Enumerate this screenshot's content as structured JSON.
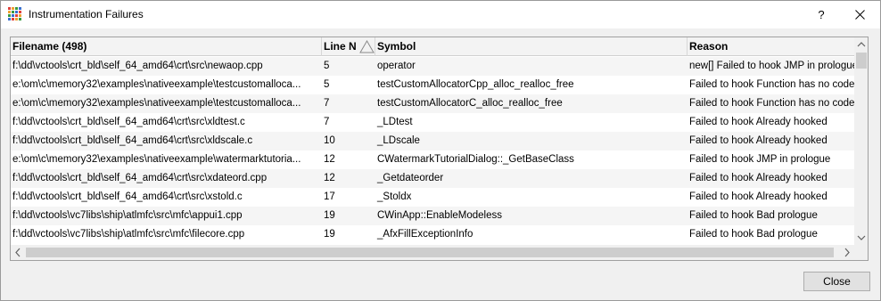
{
  "window": {
    "title": "Instrumentation Failures",
    "help_label": "?"
  },
  "table": {
    "columns": [
      {
        "label": "Filename (498)"
      },
      {
        "label": "Line N"
      },
      {
        "label": "Symbol"
      },
      {
        "label": "Reason"
      }
    ],
    "sort": {
      "column": "Line N",
      "direction": "ascending"
    },
    "rows": [
      {
        "filename": "f:\\dd\\vctools\\crt_bld\\self_64_amd64\\crt\\src\\newaop.cpp",
        "line": "5",
        "symbol": "operator",
        "reason": "new[] Failed to hook JMP in prologue"
      },
      {
        "filename": "e:\\om\\c\\memory32\\examples\\nativeexample\\testcustomalloca...",
        "line": "5",
        "symbol": "testCustomAllocatorCpp_alloc_realloc_free",
        "reason": "Failed to hook Function has no code"
      },
      {
        "filename": "e:\\om\\c\\memory32\\examples\\nativeexample\\testcustomalloca...",
        "line": "7",
        "symbol": "testCustomAllocatorC_alloc_realloc_free",
        "reason": "Failed to hook Function has no code"
      },
      {
        "filename": "f:\\dd\\vctools\\crt_bld\\self_64_amd64\\crt\\src\\xldtest.c",
        "line": "7",
        "symbol": "_LDtest",
        "reason": "Failed to hook Already hooked"
      },
      {
        "filename": "f:\\dd\\vctools\\crt_bld\\self_64_amd64\\crt\\src\\xldscale.c",
        "line": "10",
        "symbol": "_LDscale",
        "reason": "Failed to hook Already hooked"
      },
      {
        "filename": "e:\\om\\c\\memory32\\examples\\nativeexample\\watermarktutoria...",
        "line": "12",
        "symbol": "CWatermarkTutorialDialog::_GetBaseClass",
        "reason": "Failed to hook JMP in prologue"
      },
      {
        "filename": "f:\\dd\\vctools\\crt_bld\\self_64_amd64\\crt\\src\\xdateord.cpp",
        "line": "12",
        "symbol": "_Getdateorder",
        "reason": "Failed to hook Already hooked"
      },
      {
        "filename": "f:\\dd\\vctools\\crt_bld\\self_64_amd64\\crt\\src\\xstold.c",
        "line": "17",
        "symbol": "_Stoldx",
        "reason": "Failed to hook Already hooked"
      },
      {
        "filename": "f:\\dd\\vctools\\vc7libs\\ship\\atlmfc\\src\\mfc\\appui1.cpp",
        "line": "19",
        "symbol": "CWinApp::EnableModeless",
        "reason": "Failed to hook Bad prologue"
      },
      {
        "filename": "f:\\dd\\vctools\\vc7libs\\ship\\atlmfc\\src\\mfc\\filecore.cpp",
        "line": "19",
        "symbol": "_AfxFillExceptionInfo",
        "reason": "Failed to hook Bad prologue"
      }
    ]
  },
  "footer": {
    "close_label": "Close"
  },
  "icons": {
    "app": "instrumentation-grid-icon",
    "help": "help-icon",
    "close": "close-icon",
    "sort": "sort-ascending-icon",
    "scroll_up": "scroll-up-icon",
    "scroll_down": "scroll-down-icon",
    "scroll_left": "scroll-left-icon",
    "scroll_right": "scroll-right-icon"
  }
}
